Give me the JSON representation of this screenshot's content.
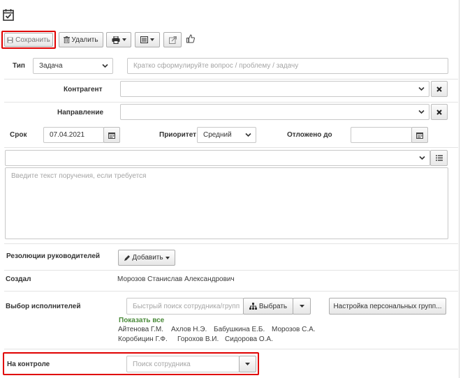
{
  "toolbar": {
    "save_label": "Сохранить",
    "delete_label": "Удалить"
  },
  "form": {
    "type_label": "Тип",
    "type_value": "Задача",
    "question_placeholder": "Кратко сформулируйте вопрос / проблему / задачу",
    "counterparty_label": "Контрагент",
    "direction_label": "Направление",
    "deadline_label": "Срок",
    "deadline_value": "07.04.2021",
    "priority_label": "Приоритет",
    "priority_value": "Средний",
    "postponed_label": "Отложено до",
    "instruction_placeholder": "Введите текст поручения, если требуется",
    "resolutions_label": "Резолюции руководителей",
    "add_label": "Добавить",
    "created_label": "Создал",
    "created_value": "Морозов Станислав Александрович",
    "executors_label": "Выбор исполнителей",
    "executor_search_placeholder": "Быстрый поиск сотрудника/групп",
    "choose_label": "Выбрать",
    "personal_groups_label": "Настройка персональных групп...",
    "show_all_label": "Показать все",
    "executors": [
      "Айтенова Г.М.",
      "Ахлов Н.Э.",
      "Бабушкина Е.Б.",
      "Морозов С.А.",
      "Коробицин Г.Ф.",
      "Горохов В.И.",
      "Сидорова О.А."
    ],
    "control_label": "На контроле",
    "control_placeholder": "Поиск сотрудника"
  },
  "colors": {
    "highlight": "#e00000",
    "link_green": "#4a8a3a"
  }
}
